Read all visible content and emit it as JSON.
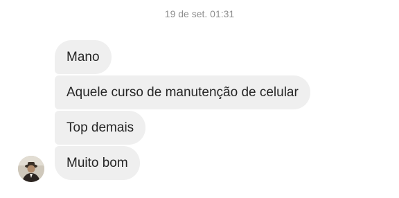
{
  "thread": {
    "timestamp": "19 de set. 01:31",
    "messages": [
      {
        "text": "Mano"
      },
      {
        "text": "Aquele curso de manutenção de celular"
      },
      {
        "text": "Top demais"
      },
      {
        "text": "Muito bom"
      }
    ],
    "sender": {
      "avatar_icon": "user-photo-avatar"
    }
  },
  "colors": {
    "background": "#ffffff",
    "bubble": "#efefef",
    "text": "#262626",
    "timestamp": "#8e8e8e"
  }
}
